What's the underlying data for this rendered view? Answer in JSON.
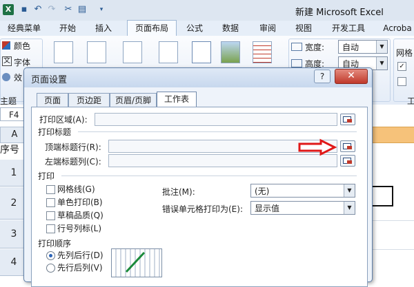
{
  "window": {
    "title": "新建 Microsoft Excel"
  },
  "ribbon": {
    "tabs": [
      "经典菜单",
      "开始",
      "插入",
      "页面布局",
      "公式",
      "数据",
      "审阅",
      "视图",
      "开发工具",
      "Acroba"
    ],
    "active_tab": "页面布局",
    "theme_group": {
      "items": [
        "颜色",
        "字体",
        "效"
      ],
      "label": "主题"
    },
    "scale_group": {
      "width_label": "宽度:",
      "width_value": "自动",
      "height_label": "高度:",
      "height_value": "自动"
    },
    "sheet_options": {
      "label": "网格",
      "group_label": "工"
    }
  },
  "sheet": {
    "name_box": "F4",
    "col_header": "A",
    "cell_header": "序号",
    "rows": [
      "1",
      "2",
      "3",
      "4"
    ]
  },
  "dialog": {
    "title": "页面设置",
    "help": "?",
    "close": "✕",
    "tabs": [
      "页面",
      "页边距",
      "页眉/页脚",
      "工作表"
    ],
    "active_tab": "工作表",
    "print_area_label": "打印区域(A):",
    "print_titles_group": "打印标题",
    "top_rows_label": "顶端标题行(R):",
    "left_cols_label": "左端标题列(C):",
    "print_group": "打印",
    "checkboxes": [
      "网格线(G)",
      "单色打印(B)",
      "草稿品质(Q)",
      "行号列标(L)"
    ],
    "comments_label": "批注(M):",
    "comments_value": "(无)",
    "errors_label": "错误单元格打印为(E):",
    "errors_value": "显示值",
    "order_group": "打印顺序",
    "order_options": [
      "先列后行(D)",
      "先行后列(V)"
    ],
    "order_selected": 0
  },
  "annotation": {
    "arrow_color": "#e01818"
  }
}
